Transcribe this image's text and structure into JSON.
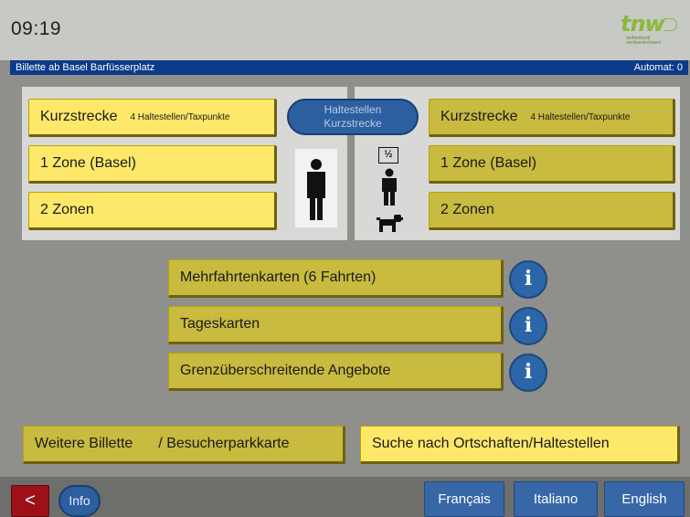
{
  "header": {
    "time": "09:19",
    "logo_text": "tnw",
    "logo_subtext": "tarifverbund nordwestschweiz"
  },
  "info_bar": {
    "location": "Billette ab Basel Barfüsserplatz",
    "automat": "Automat: 0"
  },
  "adult_tickets": {
    "kurzstrecke_label": "Kurzstrecke",
    "kurzstrecke_note": "4 Haltestellen/Taxpunkte",
    "zone1": "1 Zone (Basel)",
    "zone2": "2 Zonen"
  },
  "reduced_tickets": {
    "kurzstrecke_label": "Kurzstrecke",
    "kurzstrecke_note": "4 Haltestellen/Taxpunkte",
    "zone1": "1 Zone (Basel)",
    "zone2": "2 Zonen",
    "half_fare_label": "½"
  },
  "stops_button": {
    "line1": "Haltestellen",
    "line2": "Kurzstrecke"
  },
  "offers": [
    {
      "label": "Mehrfahrtenkarten (6 Fahrten)",
      "info": "i"
    },
    {
      "label": "Tageskarten",
      "info": "i"
    },
    {
      "label": "Grenzüberschreitende Angebote",
      "info": "i"
    }
  ],
  "bottom_actions": {
    "more_part1": "Weitere Billette",
    "more_part2": "/ Besucherparkkarte",
    "search": "Suche nach Ortschaften/Haltestellen"
  },
  "footer": {
    "back_glyph": "<",
    "info_label": "Info",
    "languages": [
      "Français",
      "Italiano",
      "English"
    ]
  },
  "icons": {
    "adult": "adult-person-icon",
    "child": "child-person-icon",
    "dog": "dog-icon",
    "info": "info-icon",
    "back": "back-arrow-icon"
  },
  "colors": {
    "brand_green": "#8cb83c",
    "info_bar_blue": "#0b3a88",
    "button_yellow": "#fde86a",
    "button_olive": "#c9ba40",
    "action_blue": "#2c5fa0",
    "back_red": "#9e1018"
  }
}
